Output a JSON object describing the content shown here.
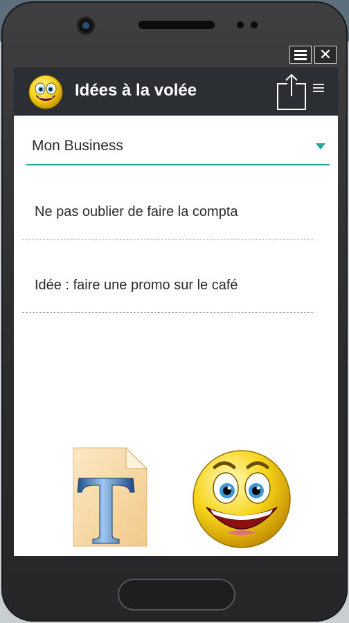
{
  "app": {
    "title": "Idées à la volée"
  },
  "window_controls": {
    "menu": "menu-icon",
    "close": "close-icon",
    "close_glyph": "✕"
  },
  "appbar": {
    "share": "share-icon",
    "overflow": "overflow-menu-icon"
  },
  "category_select": {
    "selected": "Mon Business"
  },
  "notes": [
    {
      "text": "Ne pas oublier de faire la compta"
    },
    {
      "text": "Idée : faire une promo sur le café"
    }
  ],
  "bottom_icons": {
    "text": "text-document-icon",
    "smiley": "smiley-icon"
  },
  "colors": {
    "accent": "#26a69a",
    "appbar": "#2b2f33",
    "phone_body": "#2e2e30"
  }
}
